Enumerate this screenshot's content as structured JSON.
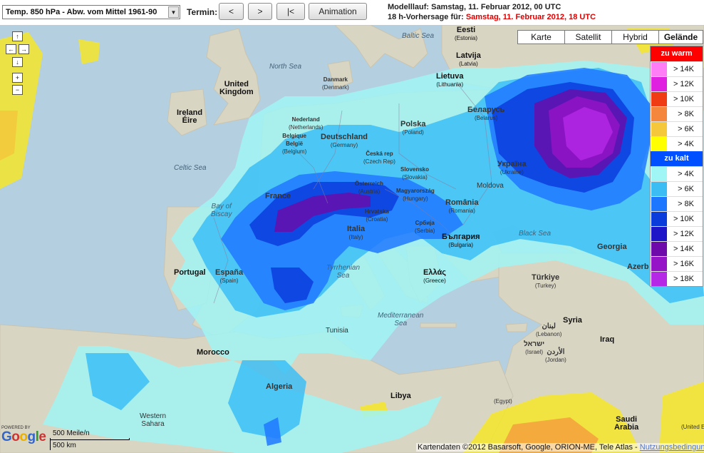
{
  "toolbar": {
    "layer_select": "Temp. 850 hPa - Abw. vom Mittel 1961-90",
    "termin_label": "Termin:",
    "prev_button": "<",
    "next_button": ">",
    "first_button": "|<",
    "animation_button": "Animation",
    "run_line": "Modelllauf: Samstag, 11. Februar 2012, 00 UTC",
    "forecast_prefix": "18 h-Vorhersage für: ",
    "forecast_value": "Samstag, 11. Februar 2012, 18 UTC"
  },
  "map_types": [
    "Karte",
    "Satellit",
    "Hybrid",
    "Gelände"
  ],
  "map_type_active": "Gelände",
  "nav": {
    "up": "↑",
    "left": "←",
    "right": "→",
    "down": "↓",
    "zoom_in": "+",
    "zoom_out": "−"
  },
  "legend": {
    "warm_header": "zu warm",
    "warm_color": "#ff0000",
    "warm_items": [
      {
        "label": "> 14K",
        "color": "#ff7ef5"
      },
      {
        "label": "> 12K",
        "color": "#e020e0"
      },
      {
        "label": "> 10K",
        "color": "#f03c14"
      },
      {
        "label": "> 8K",
        "color": "#f5873c"
      },
      {
        "label": "> 6K",
        "color": "#f5c83c"
      },
      {
        "label": "> 4K",
        "color": "#ffff00"
      }
    ],
    "cold_header": "zu kalt",
    "cold_color": "#0050ff",
    "cold_items": [
      {
        "label": "> 4K",
        "color": "#a0f5f5"
      },
      {
        "label": "> 6K",
        "color": "#3cbef5"
      },
      {
        "label": "> 8K",
        "color": "#1e78ff"
      },
      {
        "label": "> 10K",
        "color": "#0a3cdc"
      },
      {
        "label": "> 12K",
        "color": "#1e14c8"
      },
      {
        "label": "> 14K",
        "color": "#6e0aaa"
      },
      {
        "label": "> 16K",
        "color": "#9614c8"
      },
      {
        "label": "> 18K",
        "color": "#b428e6"
      }
    ]
  },
  "labels": {
    "baltic": "Baltic Sea",
    "eesti": "Eesti",
    "eesti_sub": "(Estonia)",
    "latvija": "Latvija",
    "latvija_sub": "(Latvia)",
    "lietuva": "Lietuva",
    "lietuva_sub": "(Lithuania)",
    "north_sea": "North Sea",
    "uk1": "United",
    "uk2": "Kingdom",
    "ireland": "Ireland",
    "eire": "Éire",
    "denmark": "Danmark",
    "denmark_sub": "(Denmark)",
    "nederland": "Nederland",
    "nederland_sub": "(Netherlands)",
    "belgique": "Belgique",
    "belgie": "België",
    "belgium_sub": "(Belgium)",
    "deutschland": "Deutschland",
    "deutschland_sub": "(Germany)",
    "polska": "Polska",
    "polska_sub": "(Poland)",
    "belarus": "Беларусь",
    "belarus_sub": "(Belarus)",
    "celtic": "Celtic Sea",
    "ceska": "Česká rep",
    "ceska_sub": "(Czech Rep)",
    "slovensko": "Slovensko",
    "slovensko_sub": "(Slovakia)",
    "ukraina": "Україна",
    "ukraina_sub": "(Ukraine)",
    "france": "France",
    "osterreich": "Österreich",
    "osterreich_sub": "(Austria)",
    "magyar": "Magyarország",
    "magyar_sub": "(Hungary)",
    "moldova": "Moldova",
    "biscay1": "Bay of",
    "biscay2": "Biscay",
    "romania": "România",
    "romania_sub": "(Romania)",
    "hrvatska": "Hrvatska",
    "hrvatska_sub": "(Croatia)",
    "italia": "Italia",
    "italia_sub": "(Italy)",
    "srbija": "Србија",
    "srbija_sub": "(Serbia)",
    "bulgaria": "България",
    "bulgaria_sub": "(Bulgaria)",
    "black_sea": "Black Sea",
    "georgia": "Georgia",
    "portugal": "Portugal",
    "espana": "España",
    "espana_sub": "(Spain)",
    "tyrrhenian1": "Tyrrhenian",
    "tyrrhenian2": "Sea",
    "ellas": "Ελλάς",
    "ellas_sub": "(Greece)",
    "turkiye": "Türkiye",
    "turkiye_sub": "(Turkey)",
    "azerb": "Azerb",
    "med1": "Mediterranean",
    "med2": "Sea",
    "syria": "Syria",
    "lebanon": "لبنان",
    "lebanon_sub": "(Lebanon)",
    "tunisia": "Tunisia",
    "iraq": "Iraq",
    "israel": "ישראל",
    "israel_sub": "(Israel)",
    "jordan": "الأردن",
    "jordan_sub": "(Jordan)",
    "morocco": "Morocco",
    "algeria": "Algeria",
    "libya": "Libya",
    "egypt_sub": "(Egypt)",
    "ws1": "Western",
    "ws2": "Sahara",
    "saudi1": "Saudi",
    "saudi2": "Arabia",
    "uae_sub": "(United Emirat"
  },
  "footer": {
    "powered_by": "POWERED BY",
    "google": "Google",
    "scale_miles": "500 Meile/n",
    "scale_km": "500 km",
    "attribution": "Kartendaten ©2012 Basarsoft, Google, ORION-ME, Tele Atlas - ",
    "terms_link": "Nutzungsbedingungen"
  }
}
